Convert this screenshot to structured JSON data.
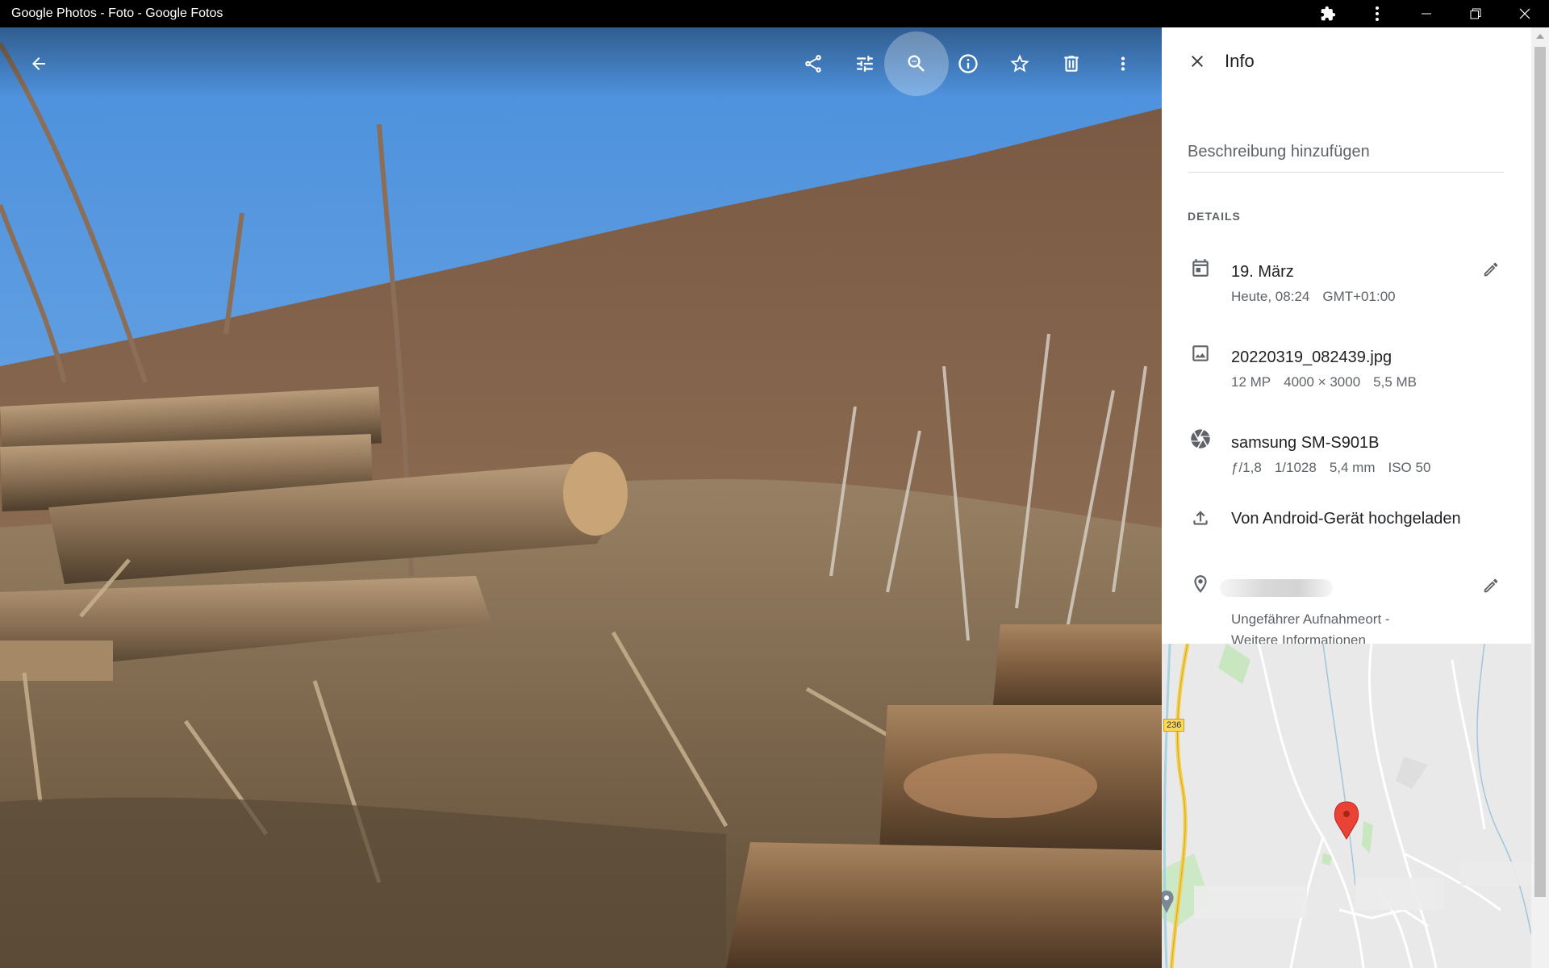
{
  "window": {
    "title": "Google Photos - Foto - Google Fotos",
    "icons": [
      "extension-icon",
      "menu-icon",
      "minimize-icon",
      "restore-icon",
      "close-icon"
    ]
  },
  "photo_toolbar": {
    "icons": [
      "back-arrow-icon",
      "share-icon",
      "edit-adjust-icon",
      "zoom-icon",
      "info-icon",
      "favorite-star-icon",
      "delete-icon",
      "more-icon"
    ],
    "active": "zoom-icon"
  },
  "info_panel": {
    "title": "Info",
    "description_placeholder": "Beschreibung hinzufügen",
    "details_label": "DETAILS",
    "date": {
      "main": "19. März",
      "sub": [
        "Heute, 08:24",
        "GMT+01:00"
      ]
    },
    "file": {
      "main": "20220319_082439.jpg",
      "sub": [
        "12 MP",
        "4000 × 3000",
        "5,5 MB"
      ]
    },
    "camera": {
      "main": "samsung SM-S901B",
      "sub": [
        "ƒ/1,8",
        "1/1028",
        "5,4 mm",
        "ISO 50"
      ]
    },
    "upload": {
      "main": "Von Android-Gerät hochgeladen"
    },
    "location": {
      "sub_line1": "Ungefährer Aufnahmeort -",
      "link": "Weitere Informationen"
    },
    "map": {
      "road_label": "236"
    }
  }
}
